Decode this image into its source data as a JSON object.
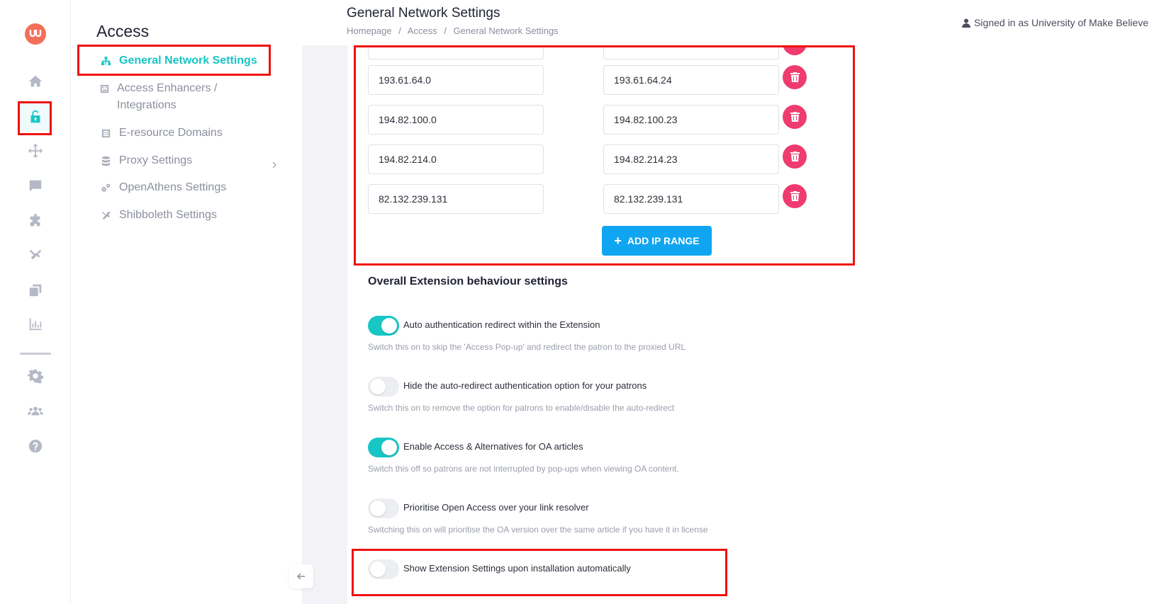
{
  "app": {
    "logo_text": "u"
  },
  "rail": {
    "items": [
      {
        "name": "home-icon"
      },
      {
        "name": "unlock-icon",
        "active": true
      },
      {
        "name": "arrows-icon"
      },
      {
        "name": "chat-icon"
      },
      {
        "name": "puzzle-icon"
      },
      {
        "name": "tools-icon"
      },
      {
        "name": "stack-icon"
      },
      {
        "name": "bar-chart-icon"
      },
      {
        "name": "gear-icon"
      },
      {
        "name": "users-icon"
      },
      {
        "name": "help-icon"
      }
    ]
  },
  "subnav": {
    "title": "Access",
    "items": [
      {
        "label": "General Network Settings",
        "icon": "network-icon",
        "active": true
      },
      {
        "label": "Access Enhancers / Integrations",
        "icon": "enhancer-icon"
      },
      {
        "label": "E-resource Domains",
        "icon": "list-icon"
      },
      {
        "label": "Proxy Settings",
        "icon": "database-icon",
        "has_submenu": true
      },
      {
        "label": "OpenAthens Settings",
        "icon": "cogs-icon"
      },
      {
        "label": "Shibboleth Settings",
        "icon": "wrench-icon"
      }
    ]
  },
  "header": {
    "title": "General Network Settings",
    "breadcrumb": [
      "Homepage",
      "/",
      "Access",
      "/",
      "General Network Settings"
    ],
    "signed_in": "Signed in as University of Make Believe"
  },
  "ip_ranges": [
    {
      "start": "193.61.64.0",
      "end": "193.61.64.24"
    },
    {
      "start": "194.82.100.0",
      "end": "194.82.100.23"
    },
    {
      "start": "194.82.214.0",
      "end": "194.82.214.23"
    },
    {
      "start": "82.132.239.131",
      "end": "82.132.239.131"
    }
  ],
  "add_ip_label": "ADD IP RANGE",
  "extension": {
    "title": "Overall Extension behaviour settings",
    "settings": [
      {
        "label": "Auto authentication redirect within the Extension",
        "help": "Switch this on to skip the 'Access Pop-up' and redirect the patron to the proxied URL",
        "enabled": true
      },
      {
        "label": "Hide the auto-redirect authentication option for your patrons",
        "help": "Switch this on to remove the option for patrons to enable/disable the auto-redirect",
        "enabled": false
      },
      {
        "label": "Enable Access & Alternatives for OA articles",
        "help": "Switch this off so patrons are not interrupted by pop-ups when viewing OA content.",
        "enabled": true
      },
      {
        "label": "Prioritise Open Access over your link resolver",
        "help": "Switching this on will prioritise the OA version over the same article if you have it in license",
        "enabled": false
      },
      {
        "label": "Show Extension Settings upon installation automatically",
        "help": "",
        "enabled": false
      }
    ]
  },
  "colors": {
    "accent": "#17c6c5",
    "danger": "#ef3b6e",
    "primary_button": "#10a5f0",
    "highlight": "#ee1111"
  }
}
